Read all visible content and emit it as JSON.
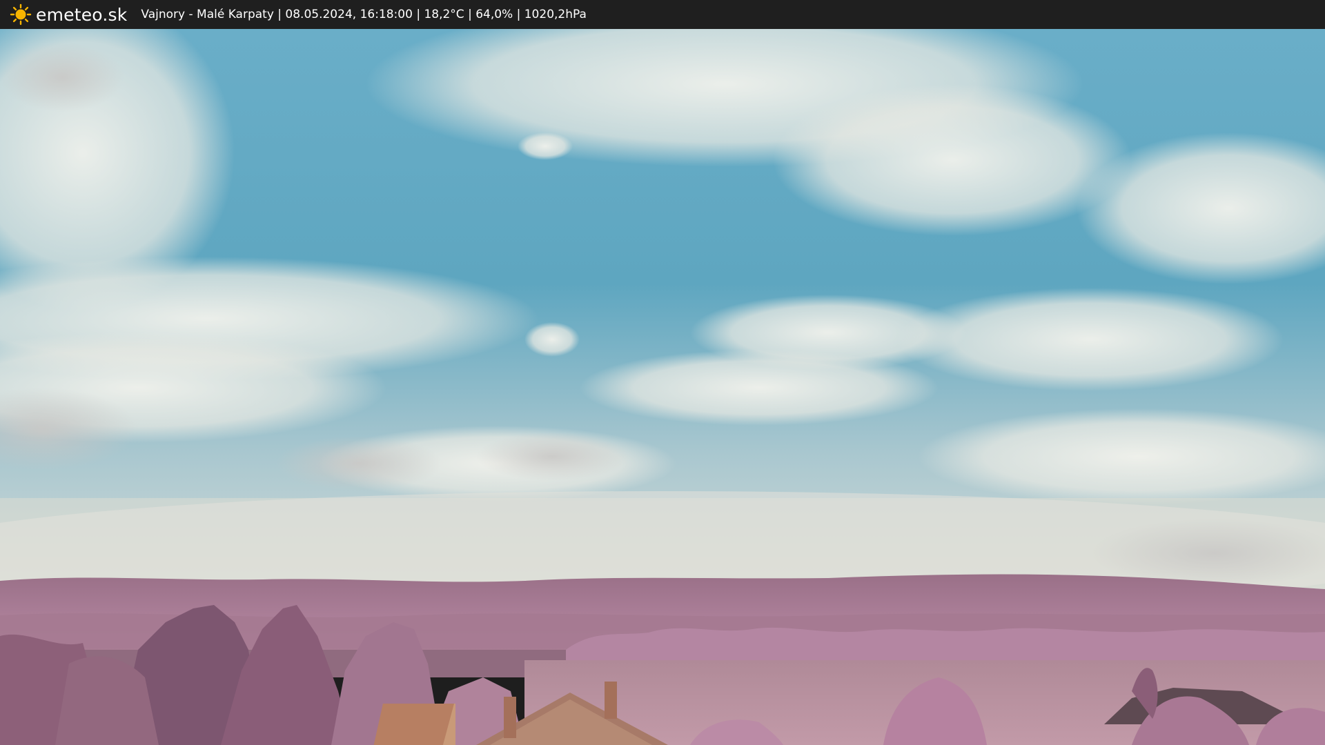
{
  "header": {
    "brand": "emeteo.sk",
    "logo_icon": "sun-icon",
    "info": "Vajnory - Malé Karpaty | 08.05.2024, 16:18:00 | 18,2°C | 64,0% | 1020,2hPa"
  },
  "colors": {
    "bar_background": "#1f1f1f",
    "sun": "#f7b500",
    "sky": "#5aa7c2",
    "foliage": "#b07a9a"
  }
}
